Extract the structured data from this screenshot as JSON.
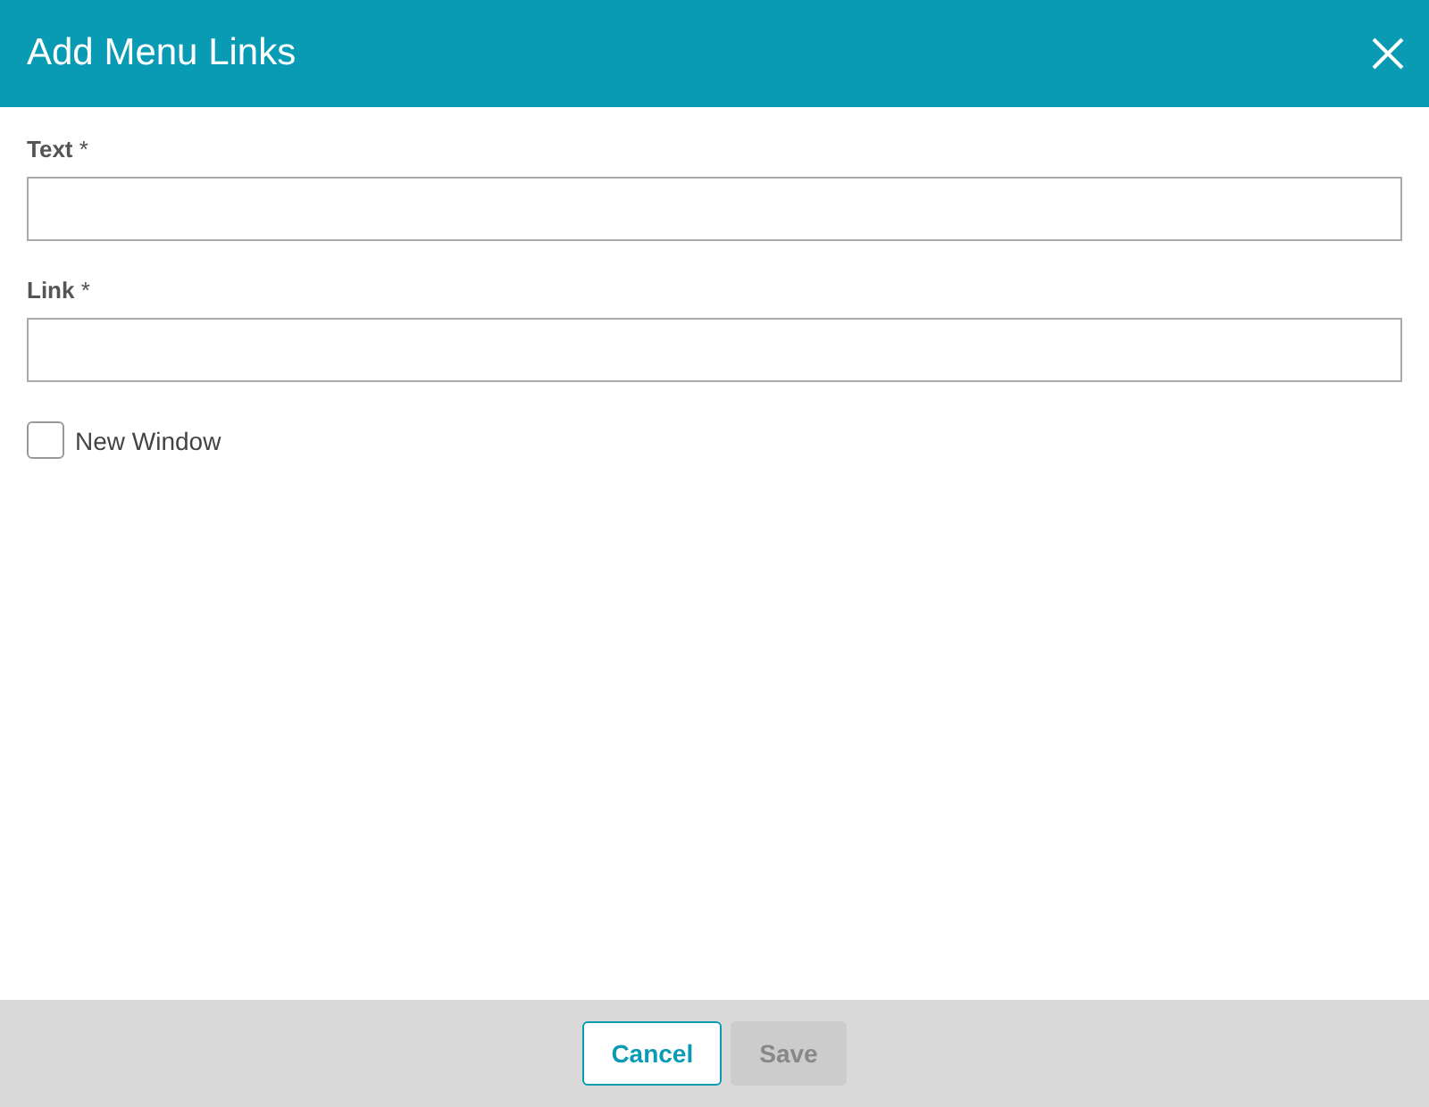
{
  "window": {
    "title": "Add Menu Links"
  },
  "fields": [
    {
      "label": "Text",
      "required_mark": "*"
    },
    {
      "label": "Link",
      "required_mark": "*"
    }
  ],
  "new_window": {
    "label": "New Window",
    "checked": false
  },
  "buttons": [
    {
      "label": "Cancel",
      "disabled": false
    },
    {
      "label": "Save",
      "disabled": true
    }
  ]
}
